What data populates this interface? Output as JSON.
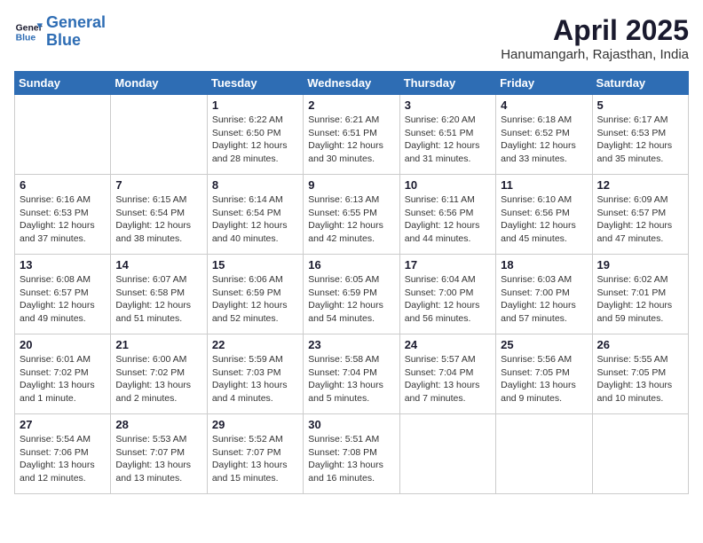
{
  "logo": {
    "line1": "General",
    "line2": "Blue"
  },
  "title": "April 2025",
  "subtitle": "Hanumangarh, Rajasthan, India",
  "days_of_week": [
    "Sunday",
    "Monday",
    "Tuesday",
    "Wednesday",
    "Thursday",
    "Friday",
    "Saturday"
  ],
  "weeks": [
    [
      {
        "day": "",
        "info": ""
      },
      {
        "day": "",
        "info": ""
      },
      {
        "day": "1",
        "info": "Sunrise: 6:22 AM\nSunset: 6:50 PM\nDaylight: 12 hours and 28 minutes."
      },
      {
        "day": "2",
        "info": "Sunrise: 6:21 AM\nSunset: 6:51 PM\nDaylight: 12 hours and 30 minutes."
      },
      {
        "day": "3",
        "info": "Sunrise: 6:20 AM\nSunset: 6:51 PM\nDaylight: 12 hours and 31 minutes."
      },
      {
        "day": "4",
        "info": "Sunrise: 6:18 AM\nSunset: 6:52 PM\nDaylight: 12 hours and 33 minutes."
      },
      {
        "day": "5",
        "info": "Sunrise: 6:17 AM\nSunset: 6:53 PM\nDaylight: 12 hours and 35 minutes."
      }
    ],
    [
      {
        "day": "6",
        "info": "Sunrise: 6:16 AM\nSunset: 6:53 PM\nDaylight: 12 hours and 37 minutes."
      },
      {
        "day": "7",
        "info": "Sunrise: 6:15 AM\nSunset: 6:54 PM\nDaylight: 12 hours and 38 minutes."
      },
      {
        "day": "8",
        "info": "Sunrise: 6:14 AM\nSunset: 6:54 PM\nDaylight: 12 hours and 40 minutes."
      },
      {
        "day": "9",
        "info": "Sunrise: 6:13 AM\nSunset: 6:55 PM\nDaylight: 12 hours and 42 minutes."
      },
      {
        "day": "10",
        "info": "Sunrise: 6:11 AM\nSunset: 6:56 PM\nDaylight: 12 hours and 44 minutes."
      },
      {
        "day": "11",
        "info": "Sunrise: 6:10 AM\nSunset: 6:56 PM\nDaylight: 12 hours and 45 minutes."
      },
      {
        "day": "12",
        "info": "Sunrise: 6:09 AM\nSunset: 6:57 PM\nDaylight: 12 hours and 47 minutes."
      }
    ],
    [
      {
        "day": "13",
        "info": "Sunrise: 6:08 AM\nSunset: 6:57 PM\nDaylight: 12 hours and 49 minutes."
      },
      {
        "day": "14",
        "info": "Sunrise: 6:07 AM\nSunset: 6:58 PM\nDaylight: 12 hours and 51 minutes."
      },
      {
        "day": "15",
        "info": "Sunrise: 6:06 AM\nSunset: 6:59 PM\nDaylight: 12 hours and 52 minutes."
      },
      {
        "day": "16",
        "info": "Sunrise: 6:05 AM\nSunset: 6:59 PM\nDaylight: 12 hours and 54 minutes."
      },
      {
        "day": "17",
        "info": "Sunrise: 6:04 AM\nSunset: 7:00 PM\nDaylight: 12 hours and 56 minutes."
      },
      {
        "day": "18",
        "info": "Sunrise: 6:03 AM\nSunset: 7:00 PM\nDaylight: 12 hours and 57 minutes."
      },
      {
        "day": "19",
        "info": "Sunrise: 6:02 AM\nSunset: 7:01 PM\nDaylight: 12 hours and 59 minutes."
      }
    ],
    [
      {
        "day": "20",
        "info": "Sunrise: 6:01 AM\nSunset: 7:02 PM\nDaylight: 13 hours and 1 minute."
      },
      {
        "day": "21",
        "info": "Sunrise: 6:00 AM\nSunset: 7:02 PM\nDaylight: 13 hours and 2 minutes."
      },
      {
        "day": "22",
        "info": "Sunrise: 5:59 AM\nSunset: 7:03 PM\nDaylight: 13 hours and 4 minutes."
      },
      {
        "day": "23",
        "info": "Sunrise: 5:58 AM\nSunset: 7:04 PM\nDaylight: 13 hours and 5 minutes."
      },
      {
        "day": "24",
        "info": "Sunrise: 5:57 AM\nSunset: 7:04 PM\nDaylight: 13 hours and 7 minutes."
      },
      {
        "day": "25",
        "info": "Sunrise: 5:56 AM\nSunset: 7:05 PM\nDaylight: 13 hours and 9 minutes."
      },
      {
        "day": "26",
        "info": "Sunrise: 5:55 AM\nSunset: 7:05 PM\nDaylight: 13 hours and 10 minutes."
      }
    ],
    [
      {
        "day": "27",
        "info": "Sunrise: 5:54 AM\nSunset: 7:06 PM\nDaylight: 13 hours and 12 minutes."
      },
      {
        "day": "28",
        "info": "Sunrise: 5:53 AM\nSunset: 7:07 PM\nDaylight: 13 hours and 13 minutes."
      },
      {
        "day": "29",
        "info": "Sunrise: 5:52 AM\nSunset: 7:07 PM\nDaylight: 13 hours and 15 minutes."
      },
      {
        "day": "30",
        "info": "Sunrise: 5:51 AM\nSunset: 7:08 PM\nDaylight: 13 hours and 16 minutes."
      },
      {
        "day": "",
        "info": ""
      },
      {
        "day": "",
        "info": ""
      },
      {
        "day": "",
        "info": ""
      }
    ]
  ]
}
